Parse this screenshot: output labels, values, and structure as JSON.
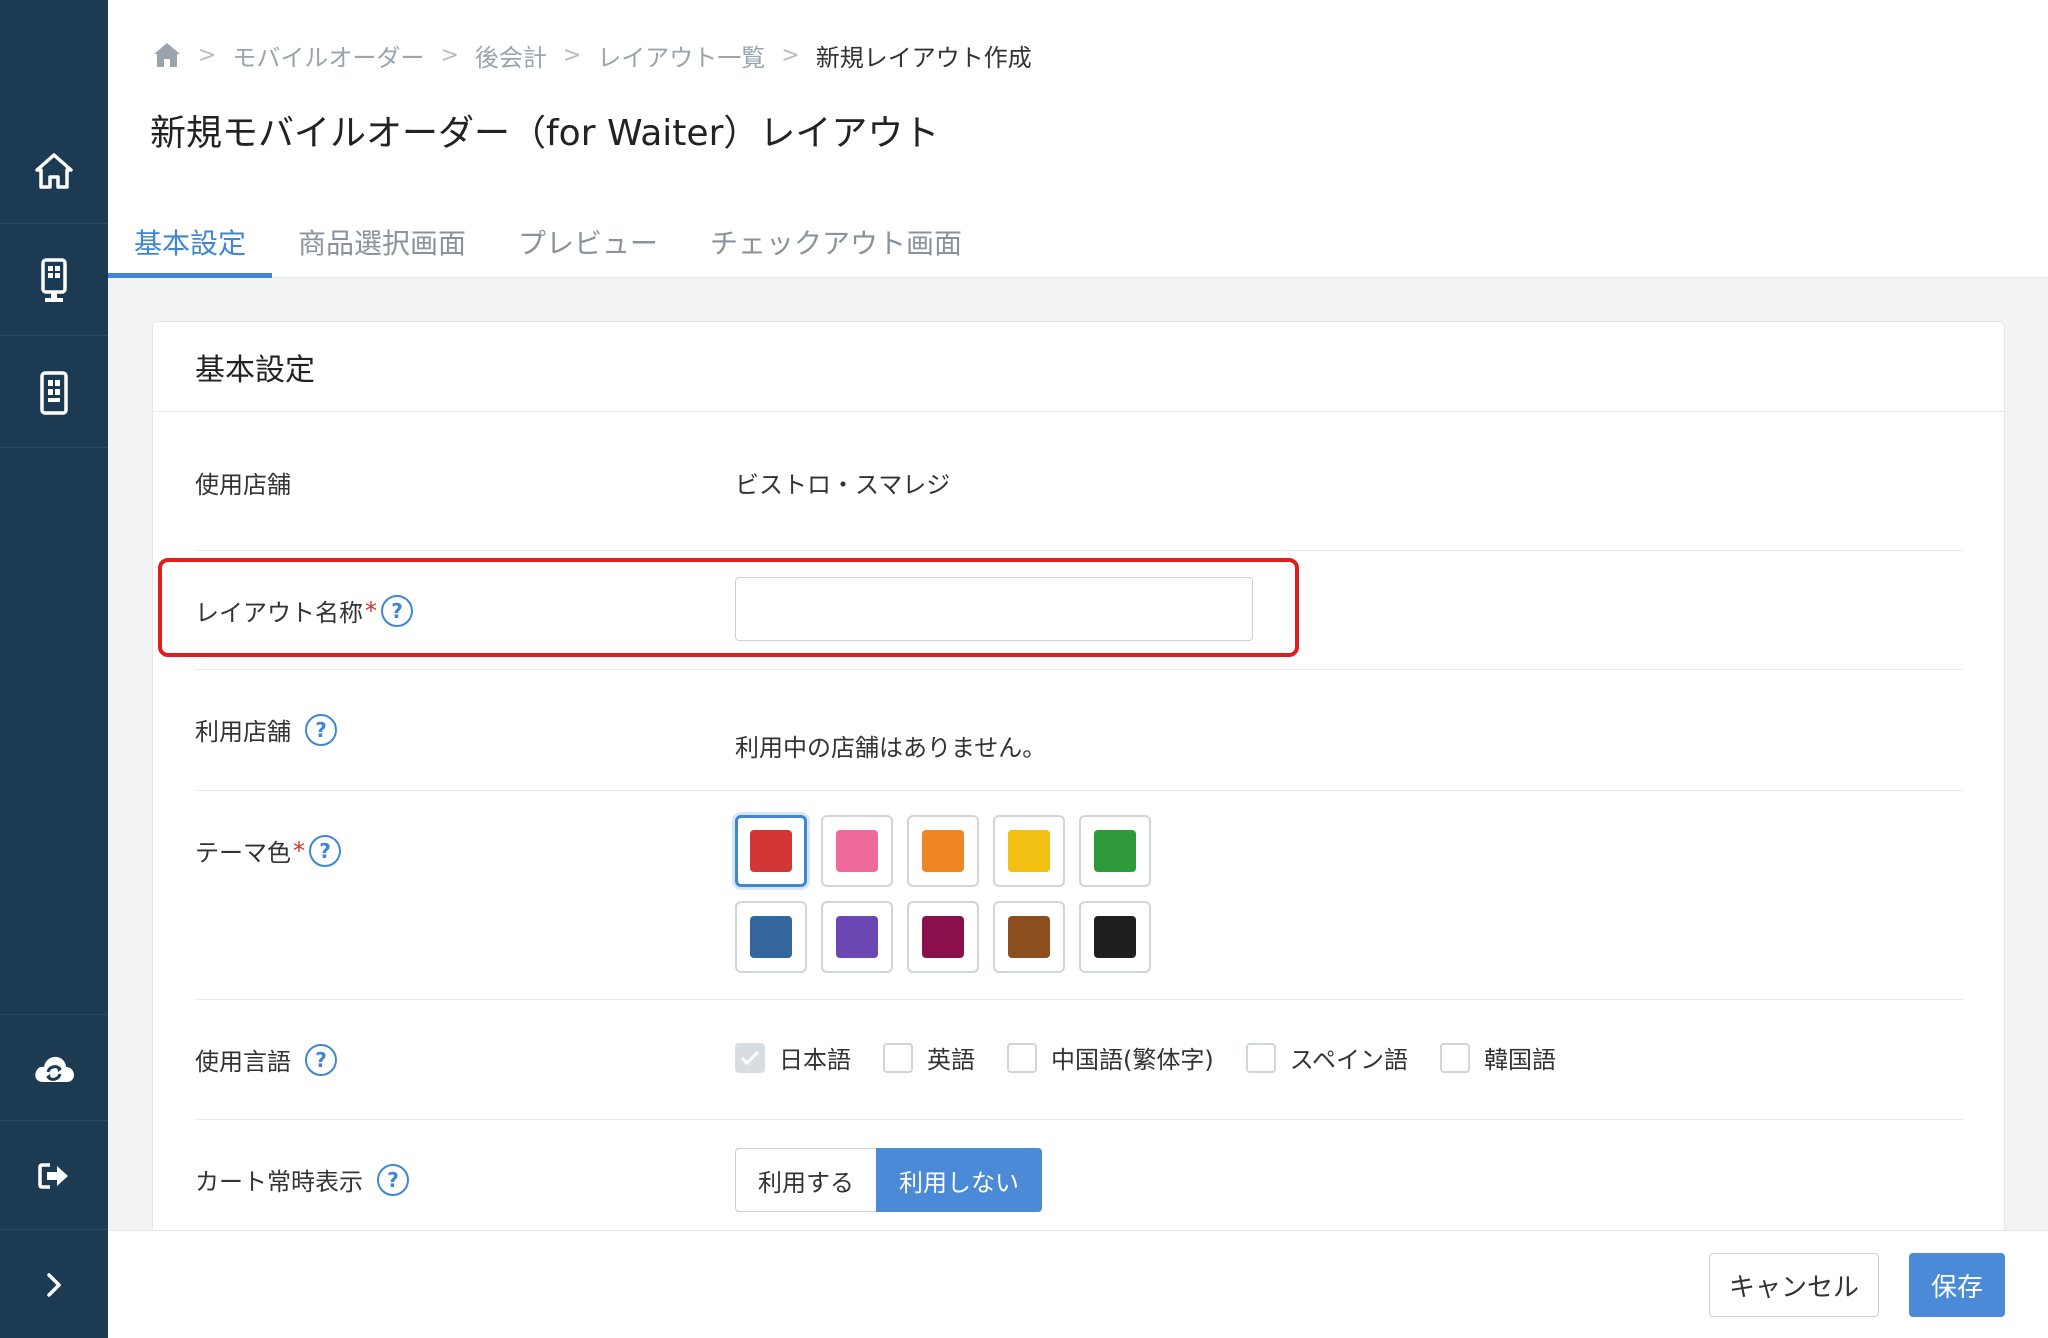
{
  "breadcrumb": {
    "items": [
      "モバイルオーダー",
      "後会計",
      "レイアウト一覧",
      "新規レイアウト作成"
    ]
  },
  "page_title": "新規モバイルオーダー（for Waiter）レイアウト",
  "tabs": [
    {
      "label": "基本設定",
      "active": true
    },
    {
      "label": "商品選択画面",
      "active": false
    },
    {
      "label": "プレビュー",
      "active": false
    },
    {
      "label": "チェックアウト画面",
      "active": false
    }
  ],
  "card": {
    "title": "基本設定",
    "store": {
      "label": "使用店舗",
      "value": "ビストロ・スマレジ"
    },
    "layout_name": {
      "label": "レイアウト名称",
      "required_mark": "*",
      "help": "?",
      "value": "",
      "placeholder": ""
    },
    "stores_in_use": {
      "label": "利用店舗",
      "help": "?",
      "value": "利用中の店舗はありません。"
    },
    "theme_color": {
      "label": "テーマ色",
      "required_mark": "*",
      "help": "?",
      "selected_index": 0,
      "colors": [
        "#d23636",
        "#ee6a9c",
        "#ee8624",
        "#f2c012",
        "#2e9a3a",
        "#33669c",
        "#6c47b4",
        "#8b0f4d",
        "#8b4f1f",
        "#1f1f1f"
      ]
    },
    "languages": {
      "label": "使用言語",
      "help": "?",
      "options": [
        {
          "label": "日本語",
          "checked": true
        },
        {
          "label": "英語",
          "checked": false
        },
        {
          "label": "中国語(繁体字)",
          "checked": false
        },
        {
          "label": "スペイン語",
          "checked": false
        },
        {
          "label": "韓国語",
          "checked": false
        }
      ]
    },
    "cart_always_show": {
      "label": "カート常時表示",
      "help": "?",
      "options": [
        "利用する",
        "利用しない"
      ],
      "selected": "利用しない"
    }
  },
  "footer": {
    "cancel_label": "キャンセル",
    "save_label": "保存"
  },
  "colors": {
    "sidebar_bg": "#1c3a52",
    "accent": "#3f86d3",
    "highlight": "#e11d1d"
  }
}
